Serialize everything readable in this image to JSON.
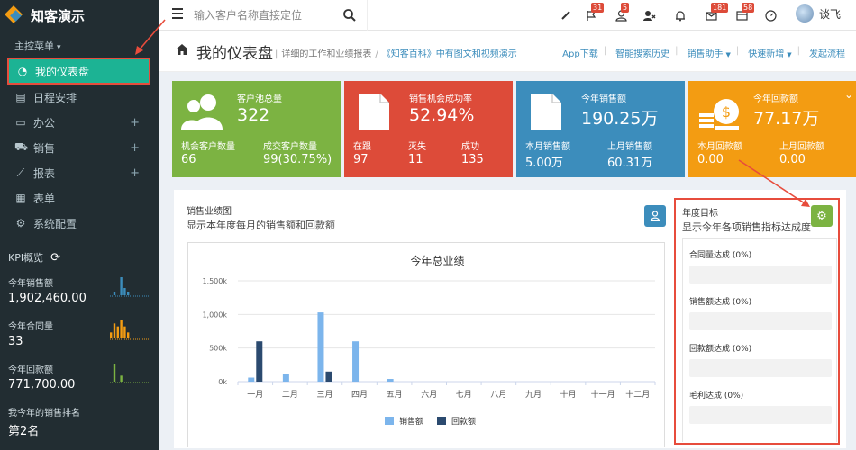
{
  "app": {
    "name": "知客演示"
  },
  "sidebar": {
    "menu_header": "主控菜单",
    "items": [
      {
        "label": "我的仪表盘",
        "icon": "dashboard-icon",
        "active": true,
        "expandable": false
      },
      {
        "label": "日程安排",
        "icon": "calendar-icon",
        "active": false,
        "expandable": false
      },
      {
        "label": "办公",
        "icon": "desktop-icon",
        "active": false,
        "expandable": true
      },
      {
        "label": "销售",
        "icon": "cart-icon",
        "active": false,
        "expandable": true
      },
      {
        "label": "报表",
        "icon": "line-chart-icon",
        "active": false,
        "expandable": true
      },
      {
        "label": "表单",
        "icon": "table-icon",
        "active": false,
        "expandable": false
      },
      {
        "label": "系统配置",
        "icon": "gear-icon",
        "active": false,
        "expandable": false
      }
    ],
    "expand_symbol": "+",
    "kpi_header": "KPI概览",
    "kpis": [
      {
        "label": "今年销售额",
        "value": "1,902,460.00",
        "spark_color": "#3c8dbc",
        "spark": [
          0,
          1,
          0,
          5,
          2,
          1,
          0,
          0,
          0,
          0,
          0,
          0
        ]
      },
      {
        "label": "今年合同量",
        "value": "33",
        "spark_color": "#f39c12",
        "spark": [
          2,
          5,
          4,
          6,
          4,
          2,
          0,
          0,
          0,
          0,
          0,
          0
        ]
      },
      {
        "label": "今年回款额",
        "value": "771,700.00",
        "spark_color": "#7cb342",
        "spark": [
          0,
          6,
          0,
          2,
          0,
          0,
          0,
          0,
          0,
          0,
          0,
          0
        ]
      },
      {
        "label": "我今年的销售排名",
        "value": "第2名"
      }
    ]
  },
  "topbar": {
    "search_placeholder": "输入客户名称直接定位",
    "badges": {
      "flag": "31",
      "user": "5",
      "bell": "",
      "mail": "181",
      "calendar": "58"
    },
    "user_name": "谈飞"
  },
  "page_header": {
    "title": "我的仪表盘",
    "desc": "详细的工作和业绩报表",
    "desc_link": "《知客百科》中有图文和视频演示",
    "links": [
      "App下载",
      "智能搜索历史",
      "销售助手",
      "快速新增",
      "发起流程"
    ]
  },
  "info_boxes": [
    {
      "title": "客户池总量",
      "value": "322",
      "color": "#7cb342",
      "icon": "users-icon",
      "sub": [
        {
          "label": "机会客户数量",
          "value": "66"
        },
        {
          "label": "成交客户数量",
          "value": "99(30.75%)"
        }
      ]
    },
    {
      "title": "销售机会成功率",
      "value": "52.94%",
      "color": "#dd4b39",
      "icon": "document-icon",
      "sub": [
        {
          "label": "在跟",
          "value": "97"
        },
        {
          "label": "灭失",
          "value": "11"
        },
        {
          "label": "成功",
          "value": "135"
        }
      ]
    },
    {
      "title": "今年销售额",
      "value": "190.25万",
      "color": "#3c8dbc",
      "icon": "document-icon",
      "sub": [
        {
          "label": "本月销售额",
          "value": "5.00万"
        },
        {
          "label": "上月销售额",
          "value": "60.31万"
        }
      ]
    },
    {
      "title": "今年回款额",
      "value": "77.17万",
      "color": "#f39c12",
      "icon": "money-icon",
      "sub": [
        {
          "label": "本月回款额",
          "value": "0.00"
        },
        {
          "label": "上月回款额",
          "value": "0.00"
        }
      ]
    }
  ],
  "sales_panel": {
    "title": "销售业绩图",
    "subtitle": "显示本年度每月的销售额和回款额"
  },
  "chart_data": {
    "type": "bar",
    "title": "今年总业绩",
    "categories": [
      "一月",
      "二月",
      "三月",
      "四月",
      "五月",
      "六月",
      "七月",
      "八月",
      "九月",
      "十月",
      "十一月",
      "十二月"
    ],
    "series": [
      {
        "name": "销售额",
        "color": "#7cb5ec",
        "values": [
          60000,
          120000,
          1030000,
          600000,
          40000,
          0,
          0,
          0,
          0,
          0,
          0,
          0
        ]
      },
      {
        "name": "回款额",
        "color": "#2b4a6f",
        "values": [
          600000,
          0,
          150000,
          0,
          0,
          0,
          0,
          0,
          0,
          0,
          0,
          0
        ]
      }
    ],
    "yticks": [
      "0k",
      "500k",
      "1,000k",
      "1,500k"
    ],
    "ylim": [
      0,
      1500000
    ],
    "legend": "bottom-center"
  },
  "goal_panel": {
    "title": "年度目标",
    "subtitle": "显示今年各项销售指标达成度",
    "items": [
      {
        "label": "合同量达成 (0%)",
        "percent": 0
      },
      {
        "label": "销售额达成 (0%)",
        "percent": 0
      },
      {
        "label": "回款额达成 (0%)",
        "percent": 0
      },
      {
        "label": "毛利达成 (0%)",
        "percent": 0
      }
    ]
  }
}
